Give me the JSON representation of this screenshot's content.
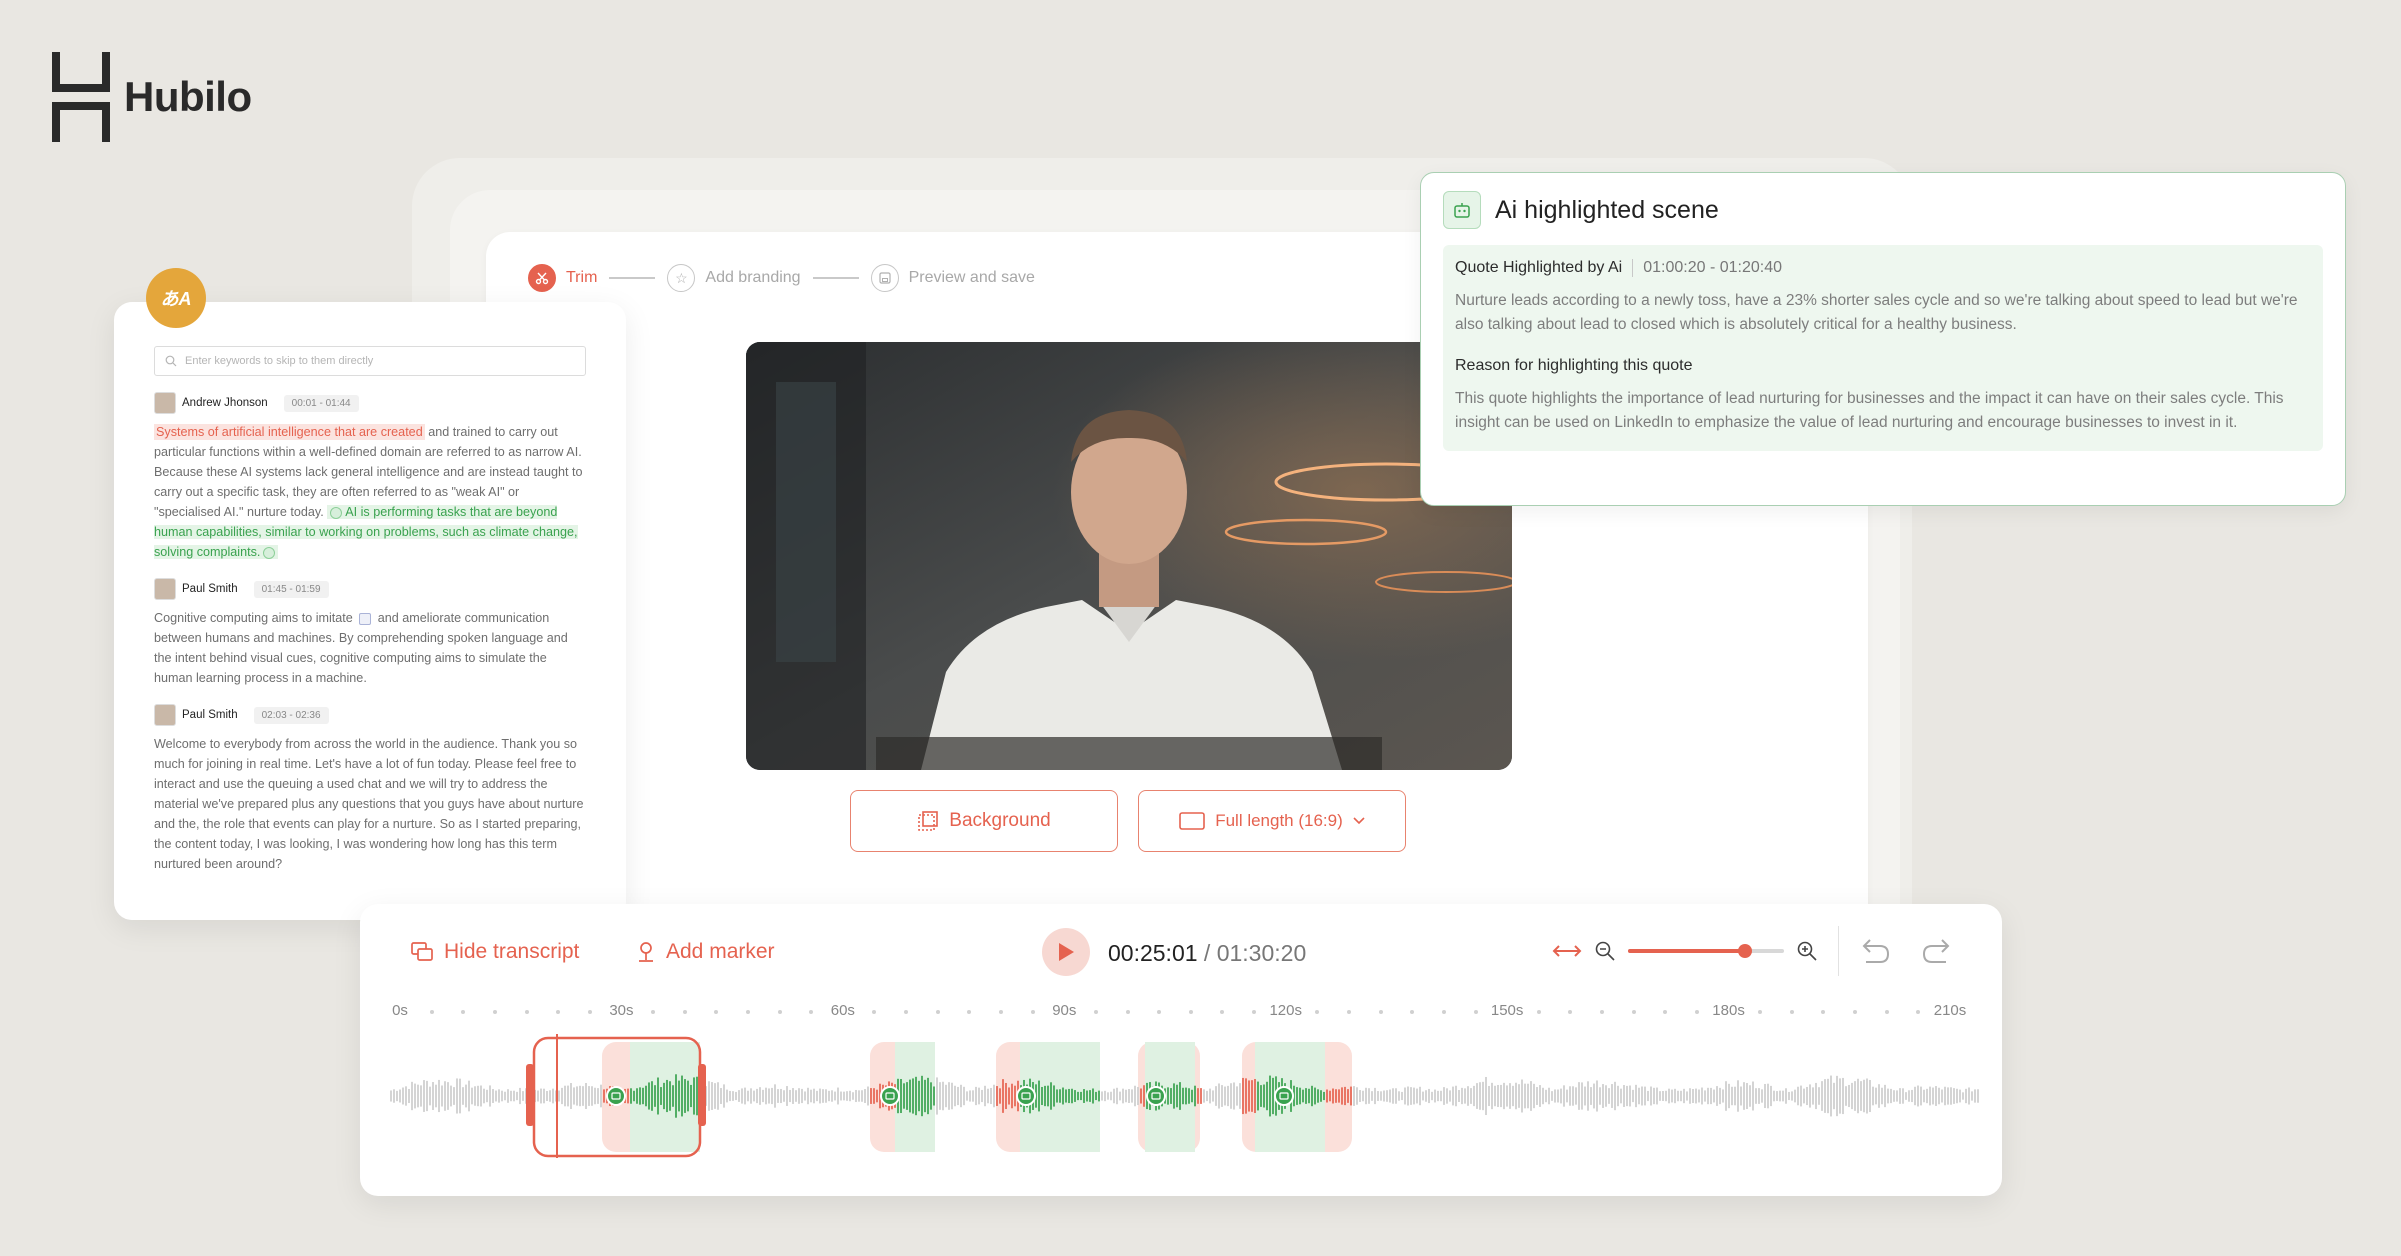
{
  "brand": {
    "name": "Hubilo"
  },
  "steps": [
    {
      "label": "Trim",
      "icon": "scissors-icon",
      "active": true
    },
    {
      "label": "Add branding",
      "icon": "star-icon",
      "active": false
    },
    {
      "label": "Preview and save",
      "icon": "save-icon",
      "active": false
    }
  ],
  "video_controls": {
    "background_label": "Background",
    "length_label": "Full length (16:9)"
  },
  "transcript": {
    "badge": "あA",
    "search_placeholder": "Enter keywords to skip to them directly",
    "entries": [
      {
        "speaker": "Andrew Jhonson",
        "time": "00:01 - 01:44",
        "highlight_red": "Systems of artificial intelligence that are created",
        "text_1": " and trained to carry out particular functions within a well-defined domain are referred to as narrow AI. Because these AI systems lack general intelligence and are instead taught to carry out a specific task, they are often referred to as \"weak AI\" or \"specialised AI.\" nurture today.",
        "highlight_green": "AI is performing  tasks that are beyond human capabilities, similar to working on problems, such as climate change, solving complaints."
      },
      {
        "speaker": "Paul Smith",
        "time": "01:45 - 01:59",
        "text_1": "Cognitive computing aims to imitate",
        "text_2": "and ameliorate communication between humans and machines. By comprehending spoken language and the intent behind visual cues, cognitive computing aims to simulate the human learning process in a machine."
      },
      {
        "speaker": "Paul Smith",
        "time": "02:03 - 02:36",
        "text_1": "Welcome to everybody from across the world in the audience. Thank you so much for joining in real time. Let's have a lot of fun today. Please feel free to interact and use the queuing a used chat and we will try to address the material we've prepared plus any questions that you guys have about nurture and the, the role that events can play for a nurture. So as I started preparing, the content today, I was looking, I was wondering how long has this term nurtured been around?"
      }
    ]
  },
  "ai_card": {
    "title": "Ai highlighted scene",
    "quote_label": "Quote Highlighted by Ai",
    "quote_range": "01:00:20 - 01:20:40",
    "quote_text": "Nurture leads according to a newly toss, have a 23% shorter sales cycle and so we're talking about speed to lead but we're also talking about lead to closed which is absolutely critical for a healthy business.",
    "reason_label": "Reason for highlighting this quote",
    "reason_text": "This quote highlights the importance of lead nurturing for businesses and the impact it can have on their sales cycle. This insight can be used on LinkedIn to emphasize the value of lead nurturing and encourage businesses to invest in it."
  },
  "timeline": {
    "hide_transcript": "Hide transcript",
    "add_marker": "Add marker",
    "current_time": "00:25:01",
    "separator": " / ",
    "total_time": "01:30:20",
    "zoom_level": 0.75,
    "ruler_labels": [
      "0s",
      "30s",
      "60s",
      "90s",
      "120s",
      "150s",
      "180s",
      "210s"
    ],
    "accent": "#e5624f",
    "green": "#3aa24f"
  }
}
